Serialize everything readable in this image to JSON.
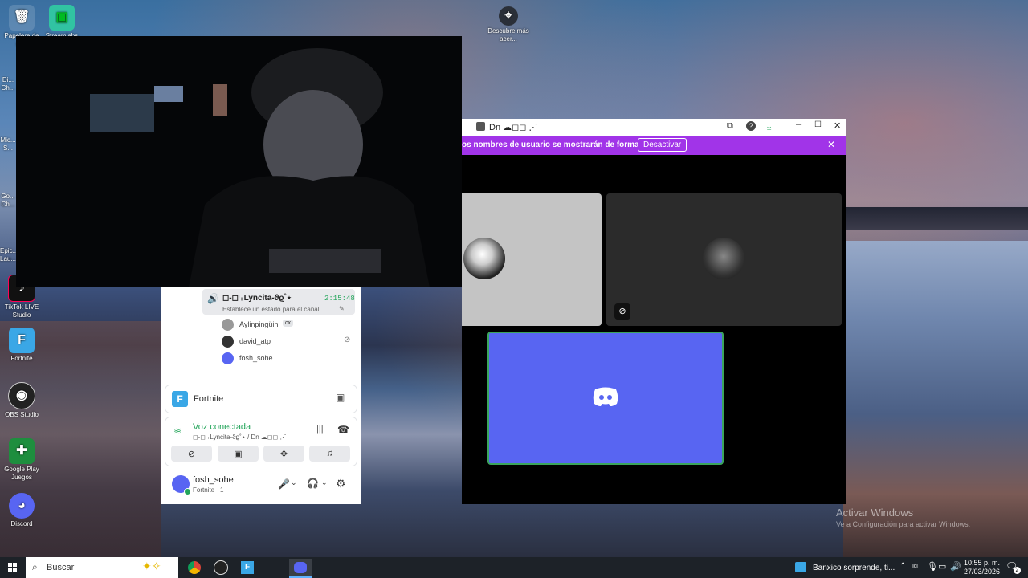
{
  "desktop": {
    "icons": [
      {
        "label": "Papelera de re..."
      },
      {
        "label": "Streamlabs"
      },
      {
        "label": "Descubre más acer..."
      },
      {
        "label": "Di... Ch..."
      },
      {
        "label": "Mic... S..."
      },
      {
        "label": "Go... Ch..."
      },
      {
        "label": "Epic... Lau..."
      },
      {
        "label": "TikTok LIVE Studio"
      },
      {
        "label": "Fortnite"
      },
      {
        "label": "OBS Studio"
      },
      {
        "label": "Google Play Juegos"
      },
      {
        "label": "Discord"
      }
    ],
    "watermark_title": "Activar Windows",
    "watermark_sub": "Ve a Configuración para activar Windows."
  },
  "discord_window": {
    "title": "Dn ☁︎◻︎◻︎ ⋰",
    "banner_text": "os nombres de usuario se mostrarán de forma parcial.",
    "banner_button": "Desactivar",
    "colors": {
      "banner": "#a134e8",
      "discord_blurple": "#5865f2"
    }
  },
  "voice_panel": {
    "channel_user": "◻︎-◻︎ᵎ₊Lyncita-ϑϱ˚⋆",
    "channel_time": "2:15:48",
    "channel_status": "Establece un estado para el canal",
    "members": [
      {
        "name": "Aylinpingüin",
        "badge": "cx"
      },
      {
        "name": "david_atp"
      },
      {
        "name": "fosh_sohe"
      }
    ],
    "activity_game": "Fortnite",
    "voice_status": "Voz conectada",
    "voice_channel": "◻︎-◻︎ᵎ₊Lyncita-ϑϱ˚⋆ / Dn ☁︎◻︎◻︎ ⋰",
    "user_name": "fosh_sohe",
    "user_activity": "Fortnite +1"
  },
  "taskbar": {
    "search_placeholder": "Buscar",
    "news": "Banxico sorprende, ti...",
    "time": "10:55 p. m.",
    "date": "27/03/2026",
    "notification_count": "2"
  }
}
